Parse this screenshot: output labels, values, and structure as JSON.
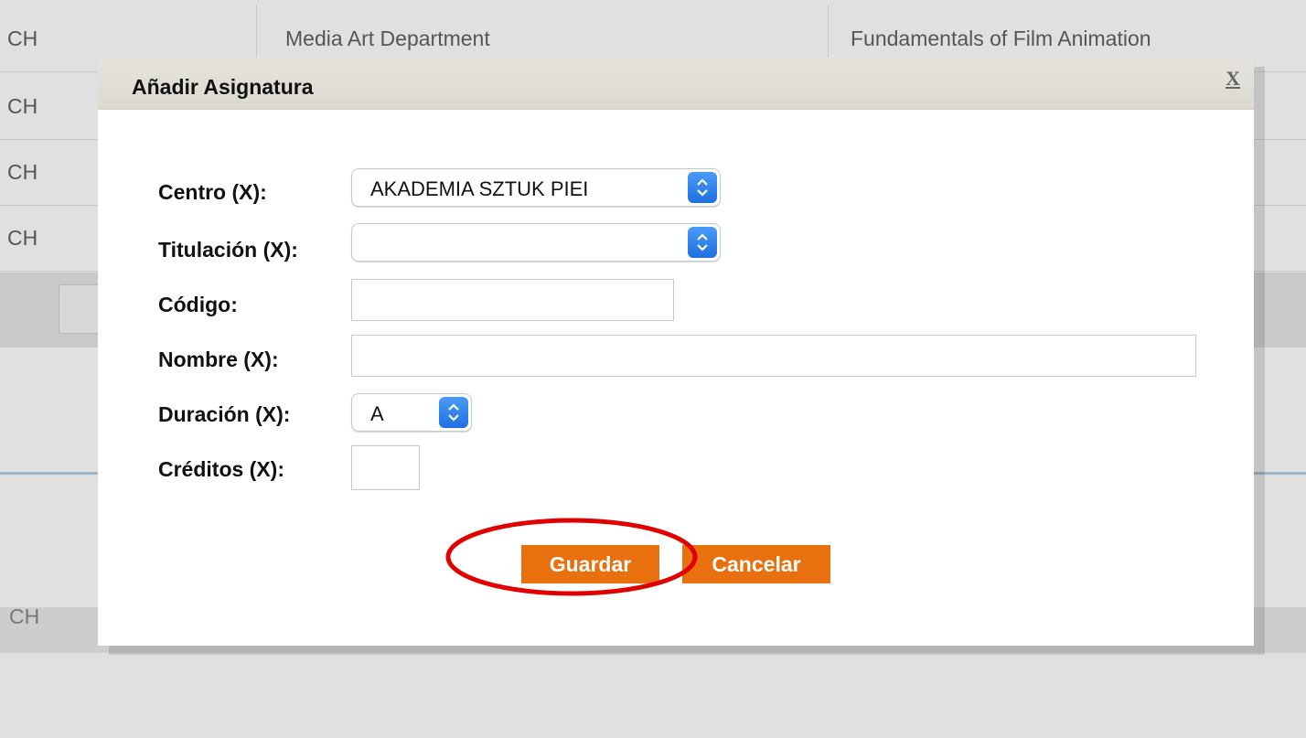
{
  "background": {
    "rows": [
      {
        "col1": "CH",
        "col2": "Media Art Department",
        "col3": "Fundamentals of Film Animation"
      },
      {
        "col1": "CH",
        "col2": "",
        "col3": ""
      },
      {
        "col1": "CH",
        "col2": "",
        "col3": ""
      },
      {
        "col1": "CH",
        "col2": "",
        "col3": ""
      }
    ],
    "partial_row_text": "CH"
  },
  "dialog": {
    "title": "Añadir Asignatura",
    "close_label": "X",
    "fields": {
      "centro": {
        "label": "Centro (X):",
        "value": "AKADEMIA SZTUK PIEI"
      },
      "titulacion": {
        "label": "Titulación (X):",
        "value": ""
      },
      "codigo": {
        "label": "Código:",
        "value": ""
      },
      "nombre": {
        "label": "Nombre (X):",
        "value": ""
      },
      "duracion": {
        "label": "Duración (X):",
        "value": "A"
      },
      "creditos": {
        "label": "Créditos (X):",
        "value": ""
      }
    },
    "buttons": {
      "save": "Guardar",
      "cancel": "Cancelar"
    }
  },
  "colors": {
    "button_orange": "#e8700f",
    "select_arrow_blue": "#2b7cf0",
    "annotation_red": "#e00000"
  },
  "icons": {
    "select_arrow": "up-down-chevron-icon"
  }
}
